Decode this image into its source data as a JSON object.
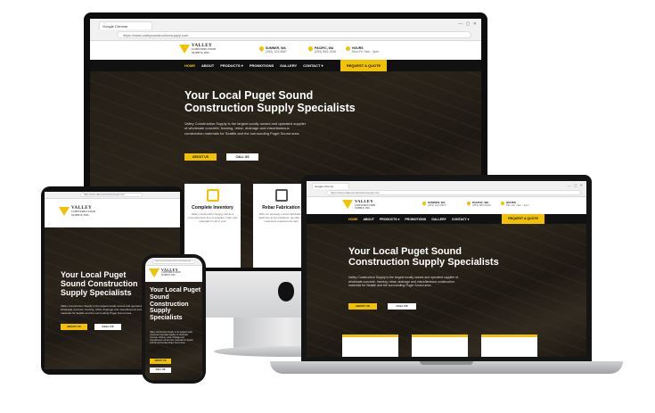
{
  "site": {
    "tab_title": "Google Chrome",
    "url": "https://www.valleyconstructionsupply.com",
    "window_controls": "— ▢ ✕",
    "logo_line1": "VALLEY",
    "logo_line2": "CONSTRUCTION",
    "logo_line3": "SUPPLY, INC.",
    "location1_name": "SUMNER, WA",
    "location1_detail": "(253) 123-4567",
    "location2_name": "PACIFIC, WA",
    "location2_detail": "(253) 863-1006",
    "hours_label": "HOURS",
    "hours_detail": "Mon-Fri 7am - 4pm",
    "nav": [
      "HOME",
      "ABOUT",
      "PRODUCTS ▾",
      "PROMOTIONS",
      "GALLERY",
      "CONTACT ▾"
    ],
    "quote_button": "REQUEST A QUOTE",
    "hero_title_line1": "Your Local Puget Sound",
    "hero_title_line2": "Construction Supply Specialists",
    "hero_title_mobile": "Your Local Puget Sound Construction Supply Specialists",
    "hero_text": "Valley Construction Supply is the largest locally owned and operated supplier of wholesale concrete, framing, rebar, drainage and miscellaneous construction materials for Seattle and the surrounding Puget Sound area.",
    "about_button": "ABOUT US",
    "call_button": "CALL US",
    "card1_title": "Complete Inventory",
    "card1_text": "Valley Construction Supply stocks a comprehensive line of supplies, tools, and materials for all of your",
    "card2_title": "Rebar Fabrication",
    "card2_text": "With our precisely current fabrication, machines at two locations, we ship our customers requirements fast"
  },
  "colors": {
    "accent": "#f2c200",
    "nav_bg": "#111111"
  }
}
